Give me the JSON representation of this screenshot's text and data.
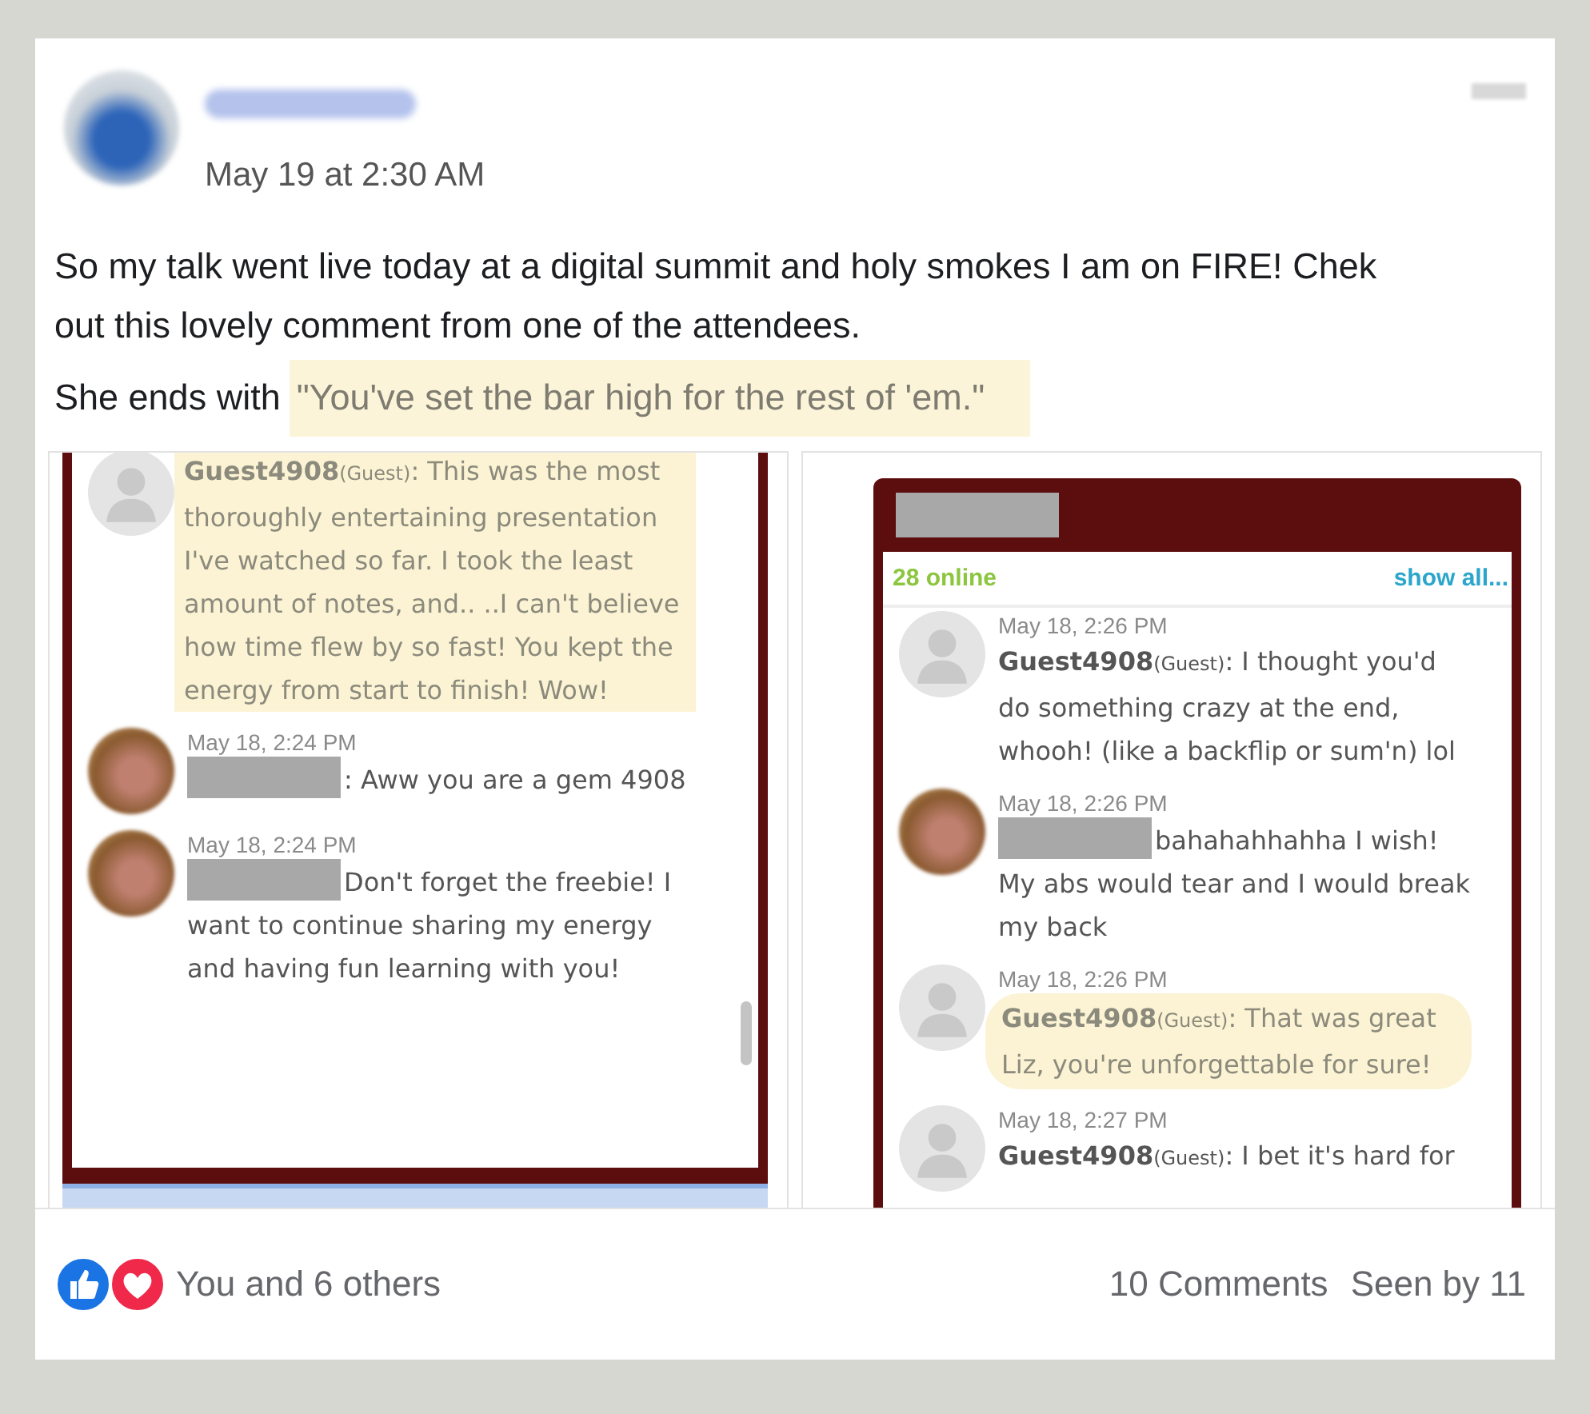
{
  "post": {
    "time": "May 19 at 2:30 AM",
    "paragraphs": [
      "So my talk went live today at a digital summit and holy smokes I am on FIRE! Chek out this lovely comment from one of the attendees."
    ],
    "quote_lead": "She ends with",
    "quote": "\"You've set the bar high for the rest of 'em.\""
  },
  "panels": [
    {
      "messages": [
        {
          "kind": "guest",
          "author": "Guest4908",
          "role": "(Guest)",
          "text": ": This was the most thoroughly entertaining presentation I've watched so far. I took the least amount of notes, and.. ..I can't believe how time flew by so fast! You kept the energy from start to finish! Wow!",
          "highlighted": true
        },
        {
          "kind": "host",
          "time": "May 18, 2:24 PM",
          "text": ": Aww you are a gem 4908",
          "highlighted": false
        },
        {
          "kind": "host",
          "time": "May 18, 2:24 PM",
          "text": "Don't forget the freebie! I want to continue sharing my energy and having fun learning with you!",
          "highlighted": false
        }
      ]
    },
    {
      "online": "28 online",
      "show_all": "show all...",
      "messages": [
        {
          "kind": "guest",
          "time": "May 18, 2:26 PM",
          "author": "Guest4908",
          "role": "(Guest)",
          "text": ": I thought you'd do something crazy at the end, whooh! (like a backflip or sum'n) lol",
          "highlighted": false
        },
        {
          "kind": "host",
          "time": "May 18, 2:26 PM",
          "text": "bahahahhahha I wish! My abs would tear and I would break my back",
          "highlighted": false
        },
        {
          "kind": "guest",
          "time": "May 18, 2:26 PM",
          "author": "Guest4908",
          "role": "(Guest)",
          "text": ": That was great Liz, you're unforgettable for sure!",
          "highlighted": true
        },
        {
          "kind": "guest",
          "time": "May 18, 2:27 PM",
          "author": "Guest4908",
          "role": "(Guest)",
          "text": ": I bet it's hard for",
          "highlighted": false
        }
      ]
    }
  ],
  "footer": {
    "reactions": "You and 6 others",
    "comments": "10 Comments",
    "seen": "Seen by 11"
  }
}
